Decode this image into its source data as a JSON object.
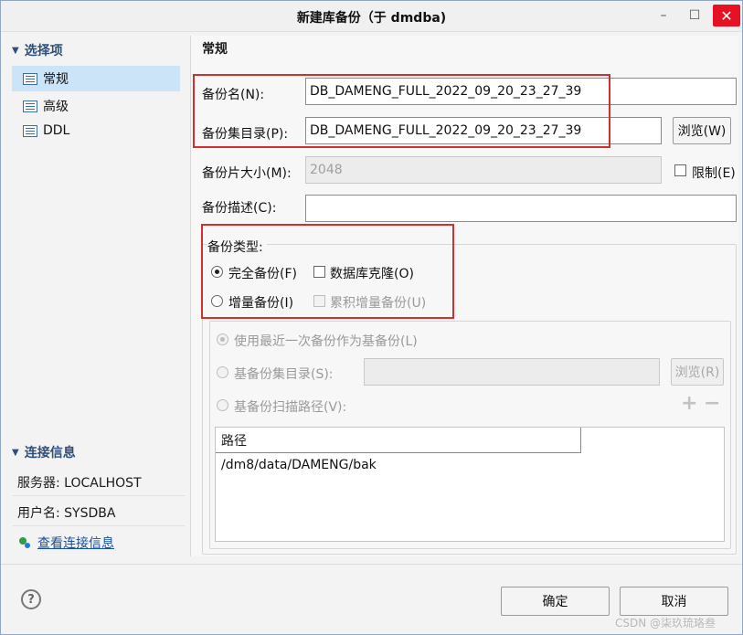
{
  "window": {
    "title": "新建库备份（于 dmdba)",
    "minimize": "–",
    "maximize": "☐",
    "close": "✕"
  },
  "sidebar": {
    "options_header": "选择项",
    "items": [
      {
        "label": "常规",
        "selected": true
      },
      {
        "label": "高级",
        "selected": false
      },
      {
        "label": "DDL",
        "selected": false
      }
    ],
    "connection_header": "连接信息",
    "server": "服务器: LOCALHOST",
    "user": "用户名: SYSDBA",
    "view_link": "查看连接信息"
  },
  "main": {
    "section_title": "常规",
    "backup_name": {
      "label": "备份名(N):",
      "value": "DB_DAMENG_FULL_2022_09_20_23_27_39"
    },
    "backup_dir": {
      "label": "备份集目录(P):",
      "value": "DB_DAMENG_FULL_2022_09_20_23_27_39",
      "browse": "浏览(W)"
    },
    "piece_size": {
      "label": "备份片大小(M):",
      "value": "2048",
      "limit": "限制(E)"
    },
    "description": {
      "label": "备份描述(C):",
      "value": ""
    },
    "backup_type": {
      "label": "备份类型:",
      "full": "完全备份(F)",
      "incremental": "增量备份(I)",
      "clone": "数据库克隆(O)",
      "cumulative": "累积增量备份(U)"
    },
    "base": {
      "use_recent": "使用最近一次备份作为基备份(L)",
      "base_dir": "基备份集目录(S):",
      "base_browse": "浏览(R)",
      "scan_path": "基备份扫描路径(V):",
      "plus": "+",
      "minus": "−",
      "table_header": "路径",
      "paths": [
        "/dm8/data/DAMENG/bak"
      ]
    }
  },
  "footer": {
    "help": "?",
    "ok": "确定",
    "cancel": "取消",
    "watermark": "CSDN @柒玖琉珞叁"
  }
}
